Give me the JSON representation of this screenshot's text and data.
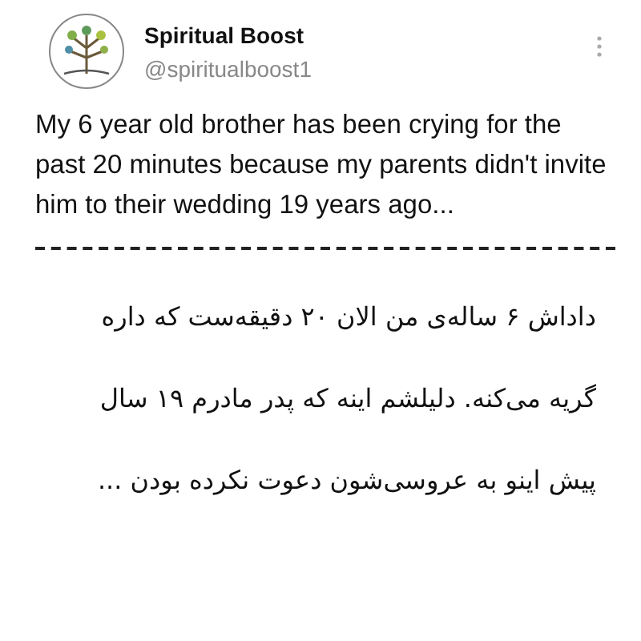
{
  "author": {
    "name": "Spiritual Boost",
    "handle": "@spiritualboost1"
  },
  "tweet": {
    "text": "My 6 year old brother has been crying for the past 20 minutes because my parents didn't invite him to their wedding 19 years ago..."
  },
  "translation": {
    "lines": [
      "داداش ۶ ساله‌ی من الان ۲۰ دقیقه‌ست که داره",
      "گریه می‌کنه. دلیلشم اینه که پدر مادرم ۱۹ سال",
      "پیش اینو به عروسی‌شون دعوت نکرده بودن ..."
    ]
  }
}
